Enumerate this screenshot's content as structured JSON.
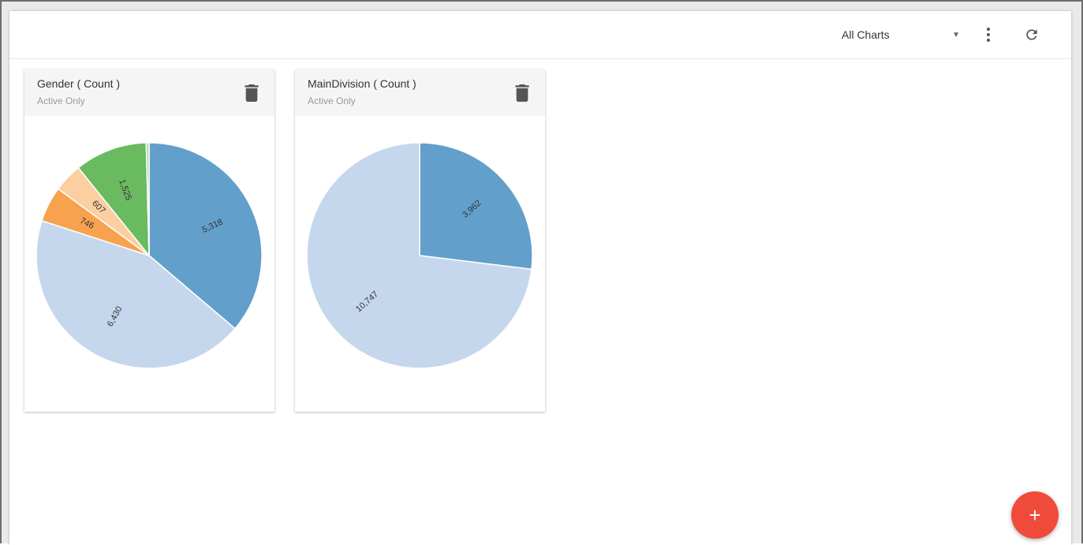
{
  "toolbar": {
    "select_value": "All Charts"
  },
  "cards": [
    {
      "title": "Gender ( Count )",
      "subtitle": "Active Only"
    },
    {
      "title": "MainDivision ( Count )",
      "subtitle": "Active Only"
    }
  ],
  "fab_label": "+",
  "chart_data": [
    {
      "type": "pie",
      "slices": [
        {
          "value": 5318,
          "label": "5,318",
          "color": "#639fcb"
        },
        {
          "value": 6430,
          "label": "6,430",
          "color": "#c5d7ed"
        },
        {
          "value": 746,
          "label": "746",
          "color": "#f6a24f"
        },
        {
          "value": 607,
          "label": "607",
          "color": "#fbcf9f"
        },
        {
          "value": 1525,
          "label": "1,525",
          "color": "#6aba60"
        },
        {
          "value": 60,
          "label": "",
          "color": "#a9dc9e"
        }
      ]
    },
    {
      "type": "pie",
      "slices": [
        {
          "value": 3962,
          "label": "3,962",
          "color": "#639fcb"
        },
        {
          "value": 10747,
          "label": "10,747",
          "color": "#c5d7ed"
        }
      ]
    }
  ]
}
